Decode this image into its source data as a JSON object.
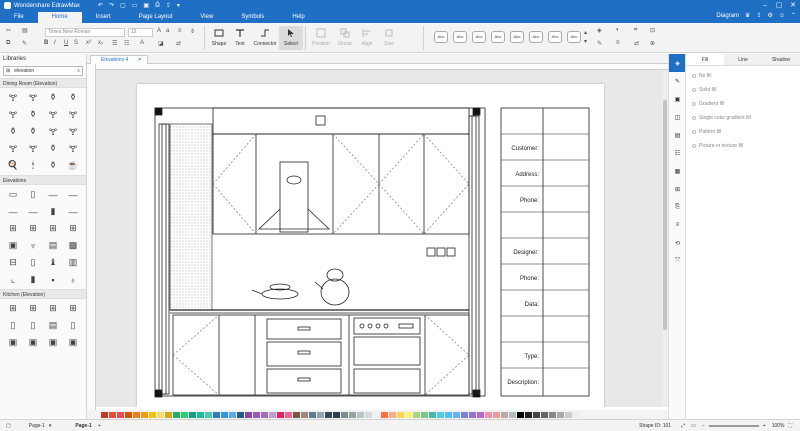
{
  "app": {
    "title": "Wondershare EdrawMax"
  },
  "menu": {
    "tabs": [
      "File",
      "Home",
      "Insert",
      "Page Layout",
      "View",
      "Symbols",
      "Help"
    ],
    "active": "Home",
    "diagram_label": "Diagram"
  },
  "ribbon": {
    "font_name": "Times New Roman",
    "font_size": "12",
    "tools": {
      "shape": "Shape",
      "text": "Text",
      "connector": "Connector",
      "select": "Select",
      "position": "Position",
      "group": "Group",
      "align": "Align",
      "size": "Size"
    },
    "style_preview": "Abc"
  },
  "libraries": {
    "title": "Libraries",
    "search_value": "elevation",
    "categories": [
      "Dining Room (Elevation)",
      "Elevations",
      "Kitchen (Elevation)"
    ]
  },
  "document": {
    "tab_label": "Elevations 4"
  },
  "drawing": {
    "table_labels": [
      "Customer:",
      "Address:",
      "Phone:",
      "Designer:",
      "Phone:",
      "Data:",
      "Type:",
      "Description:"
    ]
  },
  "fill_panel": {
    "tabs": [
      "Fill",
      "Line",
      "Shadow"
    ],
    "active_tab": "Fill",
    "options": [
      "No fill",
      "Solid fill",
      "Gradient fill",
      "Single color gradient fill",
      "Pattern fill",
      "Picture or texture fill"
    ]
  },
  "status": {
    "page_select": "Page-1",
    "page_tab": "Page-1",
    "shape_id": "Shape ID: 101",
    "zoom": "100%"
  },
  "palette_colors": [
    "#c0392b",
    "#e74c3c",
    "#e84a5f",
    "#d35400",
    "#e67e22",
    "#f39c12",
    "#f1c40f",
    "#f7dc6f",
    "#d4ac0d",
    "#27ae60",
    "#2ecc71",
    "#16a085",
    "#1abc9c",
    "#48c9b0",
    "#2980b9",
    "#3498db",
    "#5dade2",
    "#1f618d",
    "#8e44ad",
    "#9b59b6",
    "#a569bd",
    "#c39bd3",
    "#e91e63",
    "#f06292",
    "#795548",
    "#a1887f",
    "#607d8b",
    "#90a4ae",
    "#34495e",
    "#2c3e50",
    "#7f8c8d",
    "#95a5a6",
    "#bdc3c7",
    "#d5dbdb",
    "#ecf0f1",
    "#ff7043",
    "#ffab91",
    "#ffd54f",
    "#fff176",
    "#aed581",
    "#81c784",
    "#4db6ac",
    "#4dd0e1",
    "#4fc3f7",
    "#64b5f6",
    "#7986cb",
    "#9575cd",
    "#ba68c8",
    "#f48fb1",
    "#ef9a9a",
    "#bcaaa4",
    "#b0bec5",
    "#000000",
    "#222222",
    "#444444",
    "#666666",
    "#888888",
    "#aaaaaa",
    "#cccccc",
    "#eeeeee"
  ]
}
